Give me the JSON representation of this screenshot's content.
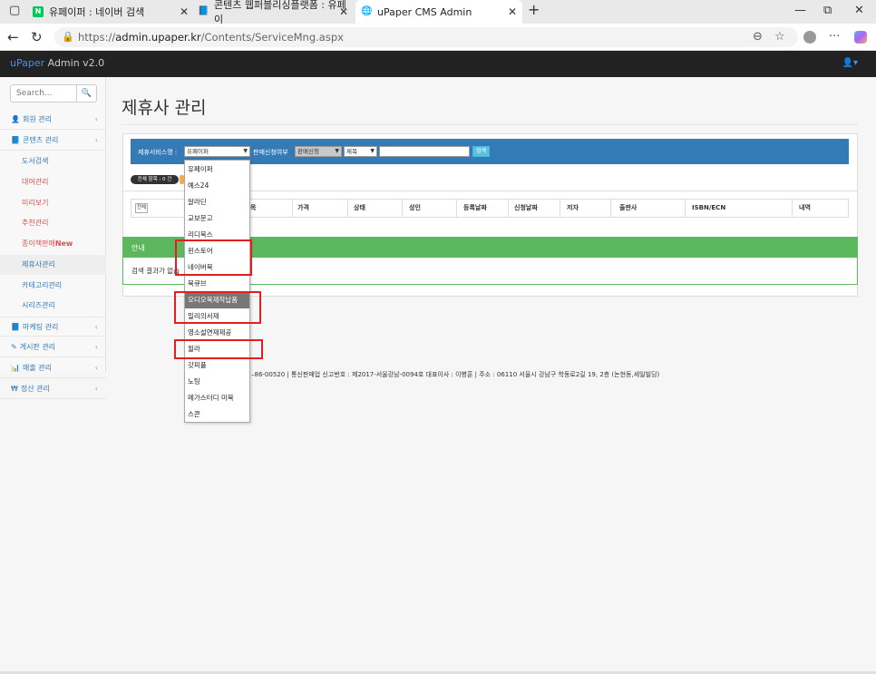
{
  "browser": {
    "tabs": [
      {
        "label": "유페이퍼 : 네이버 검색",
        "fav_color": "#03c75a",
        "fav_letter": "N"
      },
      {
        "label": "콘텐츠 웹퍼블리싱플랫폼 : 유페이",
        "fav_color": "#2b6cb0",
        "fav_letter": "📘"
      },
      {
        "label": "uPaper CMS Admin",
        "fav_color": "#666666",
        "fav_letter": "🌐"
      }
    ],
    "url_prefix": "https://",
    "url_host": "admin.upaper.kr",
    "url_path": "/Contents/ServiceMng.aspx"
  },
  "app": {
    "brand_u": "uPaper",
    "brand_rest": " Admin v2.0"
  },
  "sidebar": {
    "search_placeholder": "Search...",
    "items": [
      {
        "label": "회원 관리",
        "icon": "user-icon",
        "glyph": "👤"
      },
      {
        "label": "콘텐츠 관리",
        "icon": "book-icon",
        "glyph": "📘"
      },
      {
        "label": "마케팅 관리",
        "icon": "book-icon",
        "glyph": "📘"
      },
      {
        "label": "게시판 관리",
        "icon": "edit-icon",
        "glyph": "✎"
      },
      {
        "label": "매출 관리",
        "icon": "bar-chart-icon",
        "glyph": "📊"
      },
      {
        "label": "정산 관리",
        "icon": "won-icon",
        "glyph": "₩"
      }
    ],
    "subitems": [
      {
        "label": "도서검색",
        "style": "normal"
      },
      {
        "label": "대여관리",
        "style": "red"
      },
      {
        "label": "미리보기",
        "style": "red"
      },
      {
        "label": "추천관리",
        "style": "red"
      },
      {
        "label": "종이책판매",
        "new": "New",
        "style": "red"
      },
      {
        "label": "제휴사관리",
        "style": "active"
      },
      {
        "label": "카테고리관리",
        "style": "normal"
      },
      {
        "label": "시리즈관리",
        "style": "normal"
      }
    ]
  },
  "main": {
    "title": "제휴사 관리",
    "filter": {
      "service_label": "제휴서비스명 :",
      "service_value": "유페이퍼",
      "sale_label": "판매신청여부",
      "sale_value": "판매신청",
      "field_value": "제목",
      "search_button": "검색"
    },
    "count_badge": "전체 항목 : 0 건",
    "table_headers": [
      "전체",
      "목",
      "가격",
      "상태",
      "성인",
      "등록날짜",
      "신청날짜",
      "저자",
      "출판사",
      "ISBN/ECN",
      "내역"
    ],
    "notice_title": "안내",
    "notice_body": "검색 결과가 없습",
    "footer": "–86-00520 | 통신판매업 신고번호 : 제2017-서울강남-0094호 대표이사 : 이병훈 | 주소 : 06110 서울시 강남구 학동로2길 19, 2층 (논현동,세일빌딩)"
  },
  "dropdown": {
    "options": [
      "유페이퍼",
      "예스24",
      "알라딘",
      "교보문고",
      "리디북스",
      "윈스토어",
      "네이버북",
      "북큐브",
      "오디오북제작납품",
      "밀리의서재",
      "영소설연재제공",
      "윌라",
      "갓피플",
      "노팅",
      "메가스터디 미북",
      "스콘"
    ],
    "selected": "오디오북제작납품"
  }
}
